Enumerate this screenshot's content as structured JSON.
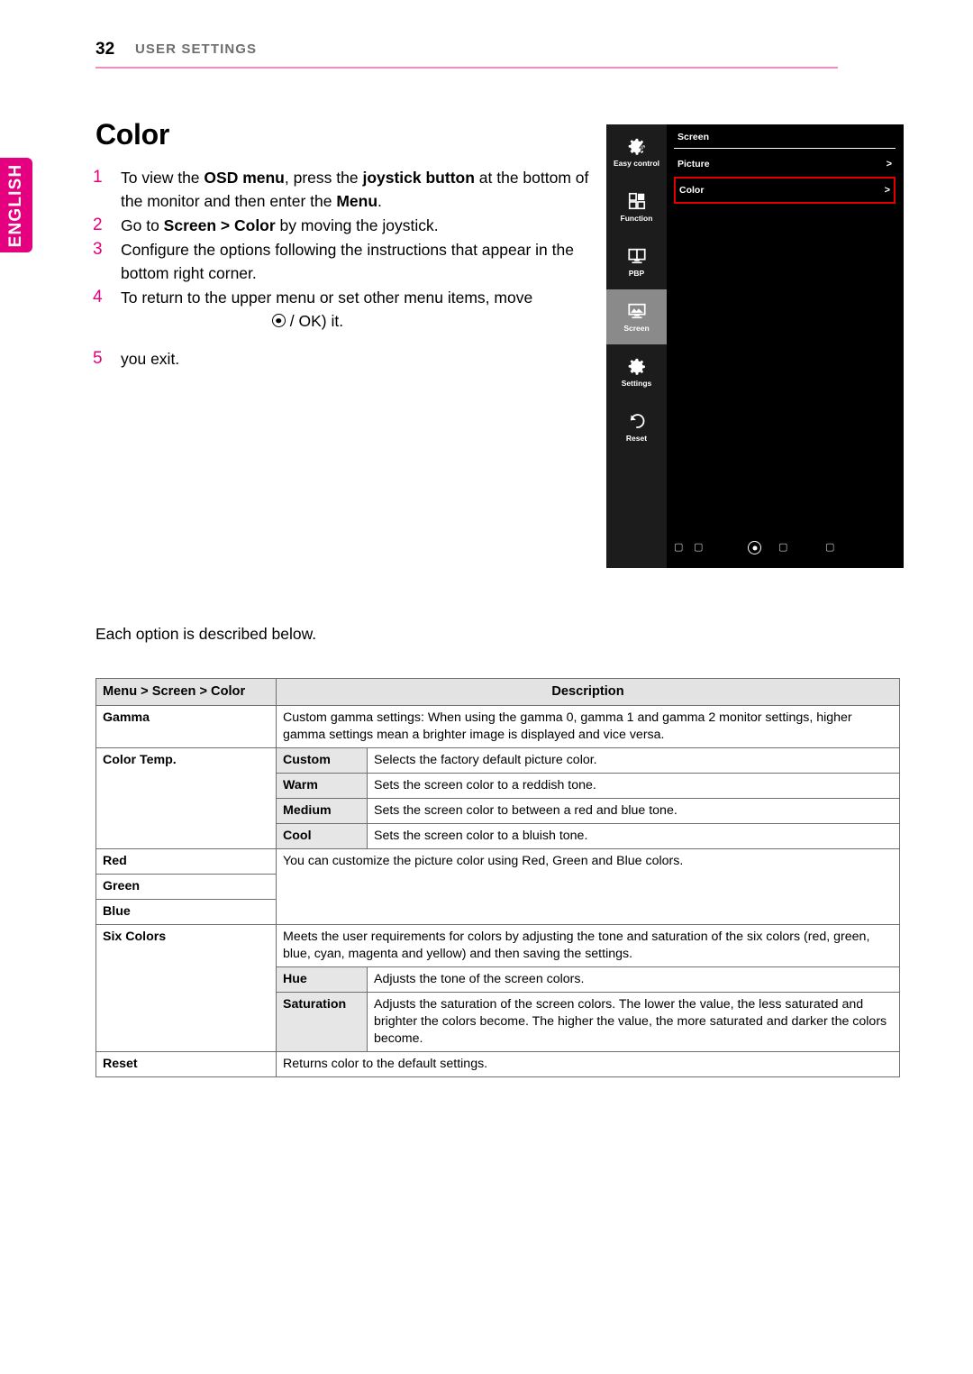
{
  "page": {
    "number": "32",
    "header_title": "USER SETTINGS",
    "language_tab": "ENGLISH",
    "section_title": "Color",
    "accent_color": "#e4007f",
    "rule_color": "#f08cc0"
  },
  "steps": [
    {
      "num": "1",
      "segments": [
        {
          "t": "To view the ",
          "b": false
        },
        {
          "t": "OSD menu",
          "b": true
        },
        {
          "t": ", press the ",
          "b": false
        },
        {
          "t": "joystick button",
          "b": true
        },
        {
          "t": " at the bottom of the monitor and then enter the ",
          "b": false
        },
        {
          "t": "Menu",
          "b": true
        },
        {
          "t": ".",
          "b": false
        }
      ]
    },
    {
      "num": "2",
      "segments": [
        {
          "t": "Go to ",
          "b": false
        },
        {
          "t": "Screen > Color",
          "b": true
        },
        {
          "t": " by moving the joystick.",
          "b": false
        }
      ]
    },
    {
      "num": "3",
      "segments": [
        {
          "t": "Configure the options following the instructions that appear in the bottom right corner.",
          "b": false
        }
      ]
    },
    {
      "num": "4",
      "segments": [
        {
          "t": "To return to the upper menu or set other menu items, move",
          "b": false
        }
      ],
      "second_line": "/ OK) it.",
      "second_line_icon": "ok-circle-icon"
    },
    {
      "num": "5",
      "segments": [],
      "trailing": "you exit."
    }
  ],
  "osd": {
    "sidebar": [
      {
        "label": "Easy control",
        "icon": "gear-bolt-icon",
        "active": false
      },
      {
        "label": "Function",
        "icon": "grid-squares-icon",
        "active": false
      },
      {
        "label": "PBP",
        "icon": "split-monitor-icon",
        "active": false
      },
      {
        "label": "Screen",
        "icon": "monitor-picture-icon",
        "active": true
      },
      {
        "label": "Settings",
        "icon": "gear-icon",
        "active": false
      },
      {
        "label": "Reset",
        "icon": "undo-arrow-icon",
        "active": false
      }
    ],
    "panel_title": "Screen",
    "rows": [
      {
        "label": "Picture",
        "chevron": ">",
        "highlighted": false
      },
      {
        "label": "Color",
        "chevron": ">",
        "highlighted": true
      }
    ],
    "highlight_color": "#e00000",
    "footer_glyphs": [
      "▢",
      "▢",
      "ok-circle-icon",
      "▢",
      "▢"
    ]
  },
  "table_intro": "Each option is described below.",
  "table": {
    "headers": {
      "menu": "Menu > Screen > Color",
      "description": "Description"
    },
    "rows": [
      {
        "menu": "Gamma",
        "sub": null,
        "description": "Custom gamma settings: When using the gamma 0, gamma 1 and gamma 2 monitor settings, higher gamma settings mean a brighter image is displayed and vice versa."
      },
      {
        "menu": "Color Temp.",
        "sub": "Custom",
        "description": "Selects the factory default picture color."
      },
      {
        "menu": "",
        "sub": "Warm",
        "description": "Sets the screen color to a reddish tone."
      },
      {
        "menu": "",
        "sub": "Medium",
        "description": "Sets the screen color to between a red and blue tone."
      },
      {
        "menu": "",
        "sub": "Cool",
        "description": "Sets the screen color to a bluish tone."
      },
      {
        "menu": "Red",
        "sub": null,
        "description": "You can customize the picture color using Red, Green and Blue colors."
      },
      {
        "menu": "Green",
        "sub": null,
        "description": ""
      },
      {
        "menu": "Blue",
        "sub": null,
        "description": ""
      },
      {
        "menu": "Six Colors",
        "sub": null,
        "description": "Meets the user requirements for colors by adjusting the tone and saturation of the six colors (red, green, blue, cyan, magenta and yellow) and then saving the settings."
      },
      {
        "menu": "",
        "sub": "Hue",
        "description": "Adjusts the tone of the screen colors."
      },
      {
        "menu": "",
        "sub": "Saturation",
        "description": "Adjusts the saturation of the screen colors. The lower the value, the less saturated and brighter the colors become. The higher the value, the more saturated and darker the colors become."
      },
      {
        "menu": "Reset",
        "sub": null,
        "description": "Returns color to the default settings."
      }
    ]
  }
}
